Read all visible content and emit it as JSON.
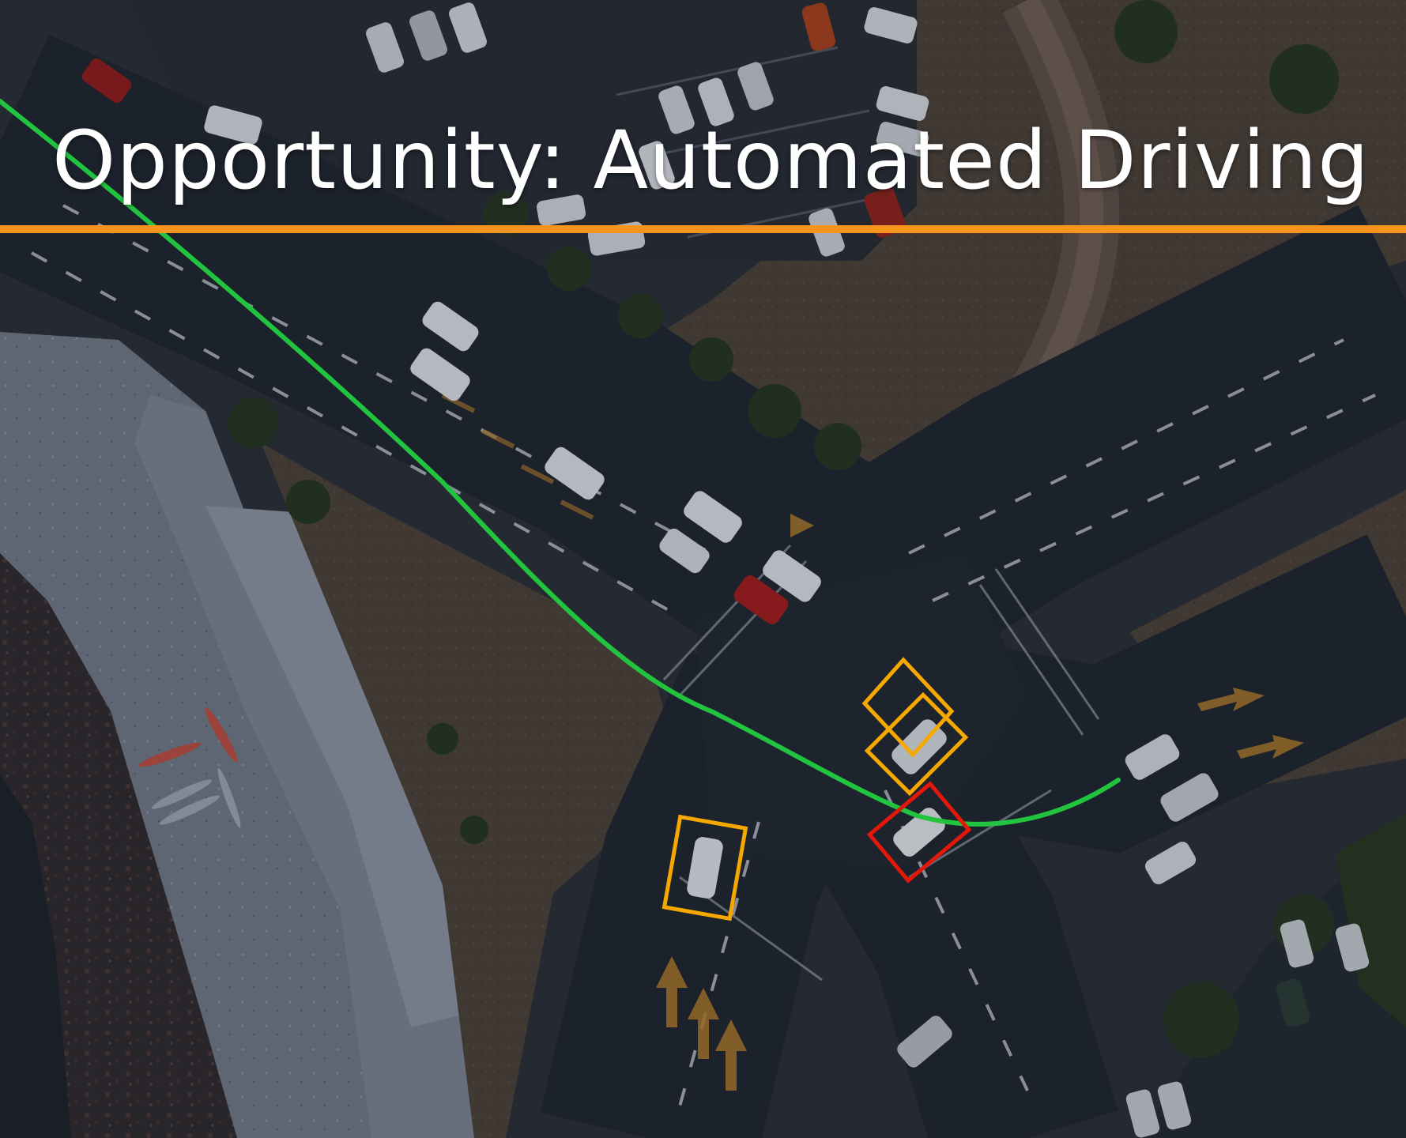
{
  "slide": {
    "title": "Opportunity: Automated Driving"
  },
  "colors": {
    "accent_rule": "#f7941d",
    "path_line": "#22c33f",
    "box_yellow": "#f5a800",
    "box_red": "#e3170a",
    "title_text": "#ffffff"
  },
  "scene": {
    "description_icons": [
      "aerial-intersection-photo",
      "planned-path-line",
      "detected-vehicle-box",
      "conflict-vehicle-box"
    ]
  }
}
